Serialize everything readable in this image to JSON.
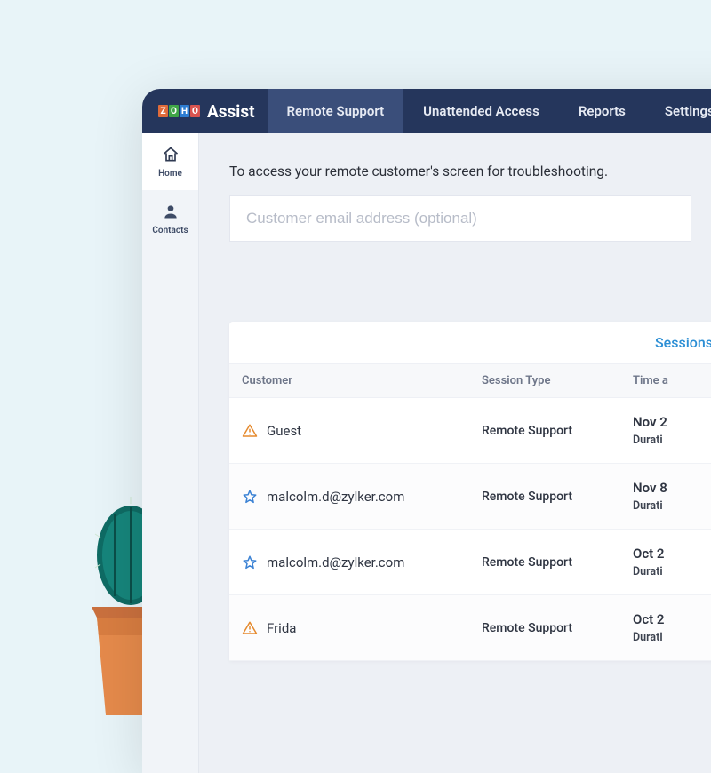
{
  "brand": {
    "name": "Assist",
    "logo_letters": [
      "Z",
      "O",
      "H",
      "O"
    ]
  },
  "nav": {
    "remote_support": "Remote Support",
    "unattended_access": "Unattended Access",
    "reports": "Reports",
    "settings": "Settings"
  },
  "sidebar": {
    "home": "Home",
    "contacts": "Contacts"
  },
  "main": {
    "access_text": "To access your remote customer's screen for troubleshooting.",
    "email_placeholder": "Customer email address (optional)"
  },
  "table": {
    "sessions_tab": "Sessions",
    "headers": {
      "customer": "Customer",
      "session_type": "Session Type",
      "time": "Time a"
    },
    "rows": [
      {
        "icon": "warn",
        "customer": "Guest",
        "type": "Remote Support",
        "date": "Nov 2",
        "duration": "Durati"
      },
      {
        "icon": "star",
        "customer": "malcolm.d@zylker.com",
        "type": "Remote Support",
        "date": "Nov 8",
        "duration": "Durati"
      },
      {
        "icon": "star",
        "customer": "malcolm.d@zylker.com",
        "type": "Remote Support",
        "date": "Oct 2",
        "duration": "Durati"
      },
      {
        "icon": "warn",
        "customer": "Frida",
        "type": "Remote Support",
        "date": "Oct 2",
        "duration": "Durati"
      }
    ]
  }
}
